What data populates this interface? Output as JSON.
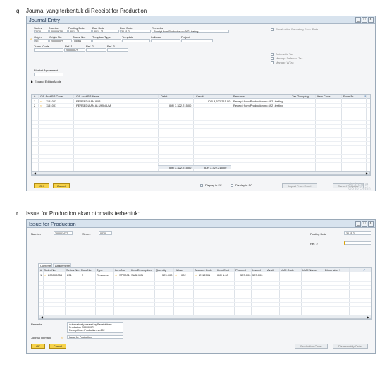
{
  "captions": {
    "q": "q.",
    "q_text": "Journal yang terbentuk di Receipt for Production",
    "r": "r.",
    "r_text": "Issue for Production akan otomatis terbentuk:"
  },
  "journal": {
    "title": "Journal Entry",
    "win_min": "_",
    "win_max": "□",
    "win_close": "×",
    "labels": {
      "series": "Series",
      "number": "Number",
      "posting_date": "Posting Date",
      "due_date": "Due Date",
      "doc_date": "Doc. Date",
      "remarks": "Remarks",
      "origin": "Origin",
      "origin_no": "Origin No.",
      "trans_no": "Trans. No.",
      "template_type": "Template Type",
      "template": "Template",
      "indicator": "Indicator",
      "project": "Project",
      "trans_code": "Trans. Code",
      "ref1": "Ref. 1",
      "ref2": "Ref. 2",
      "ref3": "Ref. 3",
      "blanket": "Blanket Agreement",
      "expand": "Expand Editing Mode"
    },
    "values": {
      "series": "2020",
      "number": "200006730",
      "posting_date": "30.11.21",
      "due_date": "30.11.21",
      "doc_date": "30.11.21",
      "remarks": "Receipt from Production no.692 -testing",
      "origin": "SE",
      "origin_no": "200000079",
      "trans_no": "55564",
      "ref1": "200000079"
    },
    "revaluation": "Revaluation Reporting Exch. Rate",
    "auto_tax": "Automatic Tax",
    "manage_deferred": "Manage Deferred Tax",
    "manage_wtax": "Manage WTax",
    "columns": [
      "#",
      "G/L Acct/BP Code",
      "G/L Acct/BP Name",
      "Debit",
      "Credit",
      "Remarks",
      "Tax Grouping",
      "Item Code",
      "From Pr..."
    ],
    "rows": [
      {
        "num": "1",
        "code": "1151002",
        "name": "PERSEDIAAN WIP",
        "debit": "",
        "credit": "IDR 3,322,215.00",
        "remarks": "Receipt from Production no.692 -testing"
      },
      {
        "num": "2",
        "code": "1151001",
        "name": "PERSEDIAAN ALUMINIUM",
        "debit": "IDR 3,322,215.00",
        "credit": "",
        "remarks": "Receipt from Production no.692 -testing"
      }
    ],
    "total_debit": "IDR 3,322,215.00",
    "total_credit": "IDR 3,322,215.00",
    "display_fc": "Display in FC",
    "display_sc": "Display in SC",
    "btn_ok": "OK",
    "btn_cancel": "Cancel",
    "btn_import": "Import From Excel",
    "btn_cancel_tpl": "Cancel Template",
    "watermark1": "Activate",
    "watermark2": "Go to Settin"
  },
  "issue": {
    "title": "Issue for Production",
    "win_min": "_",
    "win_max": "□",
    "win_close": "×",
    "labels": {
      "number": "Number",
      "series": "Series",
      "posting_date": "Posting Date",
      "ref2": "Ref. 2"
    },
    "values": {
      "number": "200001427",
      "series": "0220",
      "posting_date": "30.11.21"
    },
    "tab_contents": "Contents",
    "tab_attachments": "Attachments",
    "columns": [
      "#",
      "Order No.",
      "Series No.",
      "Row No.",
      "Type",
      "Item No.",
      "Item Description",
      "Quantity",
      "Whse",
      "Account Code",
      "Item Cost",
      "Planned",
      "Issued",
      "Avail",
      "UoM Code",
      "UoM Name",
      "Dimension 1"
    ],
    "rows": [
      {
        "num": "1",
        "order_no": "200000054",
        "series_no": "231",
        "row_no": "2",
        "type": "Resource",
        "item_no": "SPC001",
        "desc": "SUBKON",
        "qty": "570.000",
        "whse": "002",
        "account": "2112001",
        "cost": "IDR 1.00",
        "planned": "570.000",
        "issued": "570.000"
      }
    ],
    "remarks_label": "Remarks",
    "remarks_lines": [
      "Automatically created by Receipt from",
      "Production 200000079",
      "Receipt from Production no.692"
    ],
    "journal_remark_label": "Journal Remark",
    "journal_remark_value": "Issue for Production",
    "btn_ok": "OK",
    "btn_cancel": "Cancel",
    "btn_production_order": "Production Order",
    "btn_disassembly": "Disassembly Order"
  }
}
